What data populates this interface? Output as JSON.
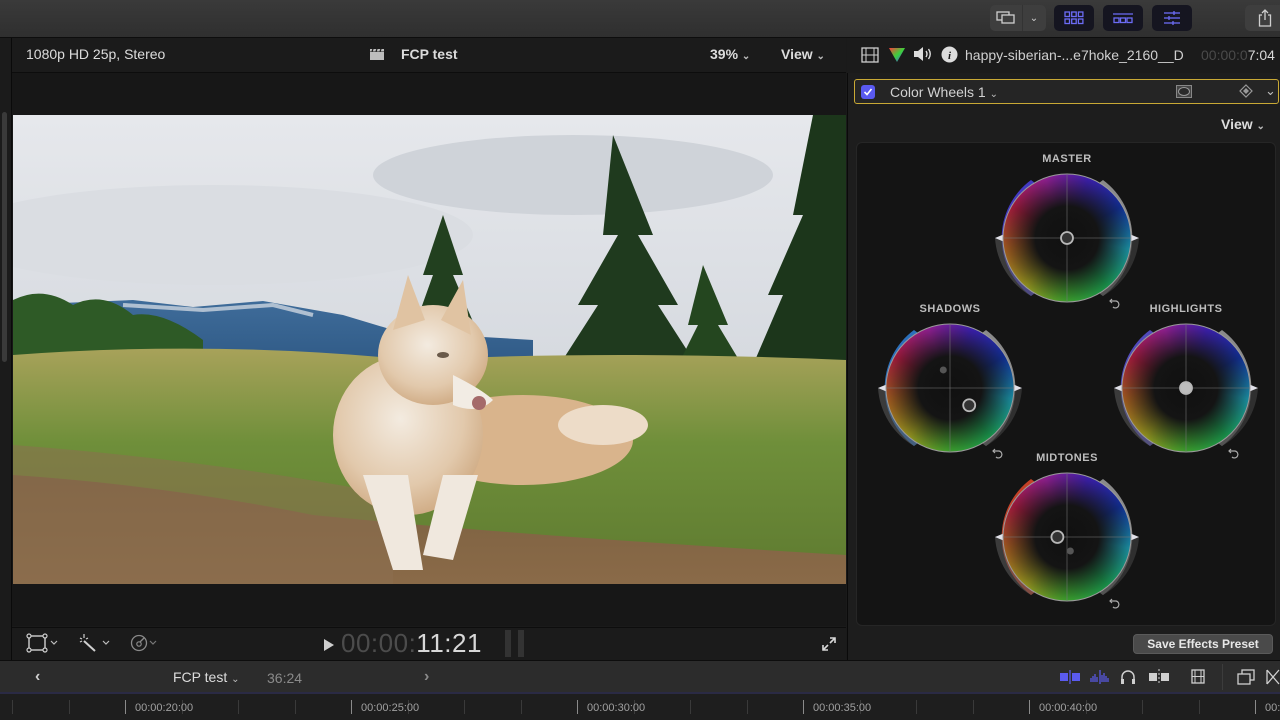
{
  "toolbar": {
    "buttons": [
      {
        "name": "show-in-display",
        "icon": "display-icon"
      },
      {
        "name": "display-options",
        "icon": "chevron-down-icon"
      },
      {
        "name": "browser-toggle",
        "icon": "grid-icon",
        "active": true
      },
      {
        "name": "timeline-toggle",
        "icon": "timeline-icon",
        "active": true
      },
      {
        "name": "inspector-toggle",
        "icon": "sliders-icon",
        "active": true
      },
      {
        "name": "share",
        "icon": "share-icon"
      }
    ],
    "accent_color": "#5b5bf0"
  },
  "viewer": {
    "format_label": "1080p HD 25p, Stereo",
    "project_name": "FCP test",
    "zoom_level": "39%",
    "view_label": "View",
    "timecode_dim": "00:00:",
    "timecode_bright": "11:21",
    "footer_tools": [
      {
        "name": "transform",
        "icon": "transform-icon"
      },
      {
        "name": "enhance",
        "icon": "magic-wand-icon"
      },
      {
        "name": "retime",
        "icon": "speedometer-icon"
      }
    ]
  },
  "inspector": {
    "clip_name": "happy-siberian-...e7hoke_2160__D",
    "timecode_dim": "00:00:0",
    "timecode_bright": "7:04",
    "effect": {
      "name": "Color Wheels 1",
      "enabled": true
    },
    "view_label": "View",
    "wheels": [
      {
        "label": "MASTER",
        "color_puck": [
          0.0,
          0.0
        ],
        "slider_color": "#4a3fe0"
      },
      {
        "label": "SHADOWS",
        "color_puck": [
          0.3,
          -0.27
        ],
        "slider_color": "#2f7fd8"
      },
      {
        "label": "HIGHLIGHTS",
        "color_puck": [
          0.0,
          0.0
        ],
        "slider_color": "#5a52d8"
      },
      {
        "label": "MIDTONES",
        "color_puck": [
          -0.15,
          0.0
        ],
        "slider_color": "#e2482a"
      }
    ],
    "save_preset_label": "Save Effects Preset"
  },
  "timeline": {
    "project_name": "FCP test",
    "duration": "36:24",
    "ruler_labels": [
      "00:00:20:00",
      "00:00:25:00",
      "00:00:30:00",
      "00:00:35:00",
      "00:00:40:00",
      "00:"
    ],
    "tools": [
      {
        "name": "skimming",
        "icon": "skimming-icon",
        "active": true
      },
      {
        "name": "audio-skimming",
        "icon": "waveform-icon",
        "active": true
      },
      {
        "name": "solo",
        "icon": "headphones-icon"
      },
      {
        "name": "snapping",
        "icon": "snapping-icon"
      },
      {
        "name": "clip-appearance",
        "icon": "filmstrip-icon"
      },
      {
        "name": "effects-browser",
        "icon": "windows-icon"
      },
      {
        "name": "transitions-browser",
        "icon": "transitions-icon"
      }
    ]
  }
}
